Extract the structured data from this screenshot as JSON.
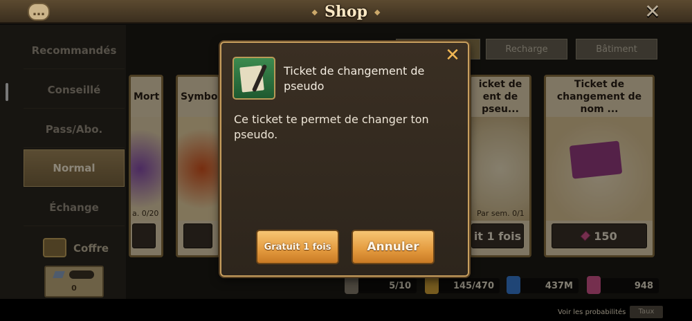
{
  "header": {
    "title": "Shop",
    "close_symbol": "✕",
    "chat_icon": "chat-bubble-icon"
  },
  "sidebar": {
    "items": [
      {
        "label": "Recommandés"
      },
      {
        "label": "Conseillé"
      },
      {
        "label": "Pass/Abo."
      },
      {
        "label": "Normal",
        "active": true
      },
      {
        "label": "Échange"
      }
    ],
    "chest_label": "Coffre",
    "chest_count": "0"
  },
  "tabs": [
    {
      "label": "",
      "active": true
    },
    {
      "label": "Recharge"
    },
    {
      "label": "Bâtiment"
    }
  ],
  "cards": [
    {
      "name": "Mort",
      "limit": "a. 0/20",
      "price": ""
    },
    {
      "name": "Symbol",
      "limit": "",
      "price": ""
    },
    {
      "name": "icket de\nent de pseu...",
      "limit": "Par sem. 0/1",
      "price": "it 1 fois"
    },
    {
      "name": "Ticket de\nchangement de nom ...",
      "limit": "",
      "price": "150"
    }
  ],
  "resources": [
    {
      "icon": "feather-icon",
      "value": "5/10"
    },
    {
      "icon": "energy-icon",
      "value": "145/470"
    },
    {
      "icon": "blue-crystal-icon",
      "value": "437M"
    },
    {
      "icon": "pink-gem-icon",
      "value": "948"
    }
  ],
  "footer": {
    "probability_link": "Voir les probabilités",
    "rate_button": "Taux"
  },
  "modal": {
    "title": "Ticket de changement de pseudo",
    "description": "Ce ticket te permet de changer ton pseudo.",
    "confirm_label": "Gratuit 1 fois",
    "cancel_label": "Annuler",
    "close_symbol": "✕"
  },
  "colors": {
    "accent_gold": "#c89f5e",
    "button_orange": "#e39a3e",
    "gem_pink": "#d6578f"
  }
}
